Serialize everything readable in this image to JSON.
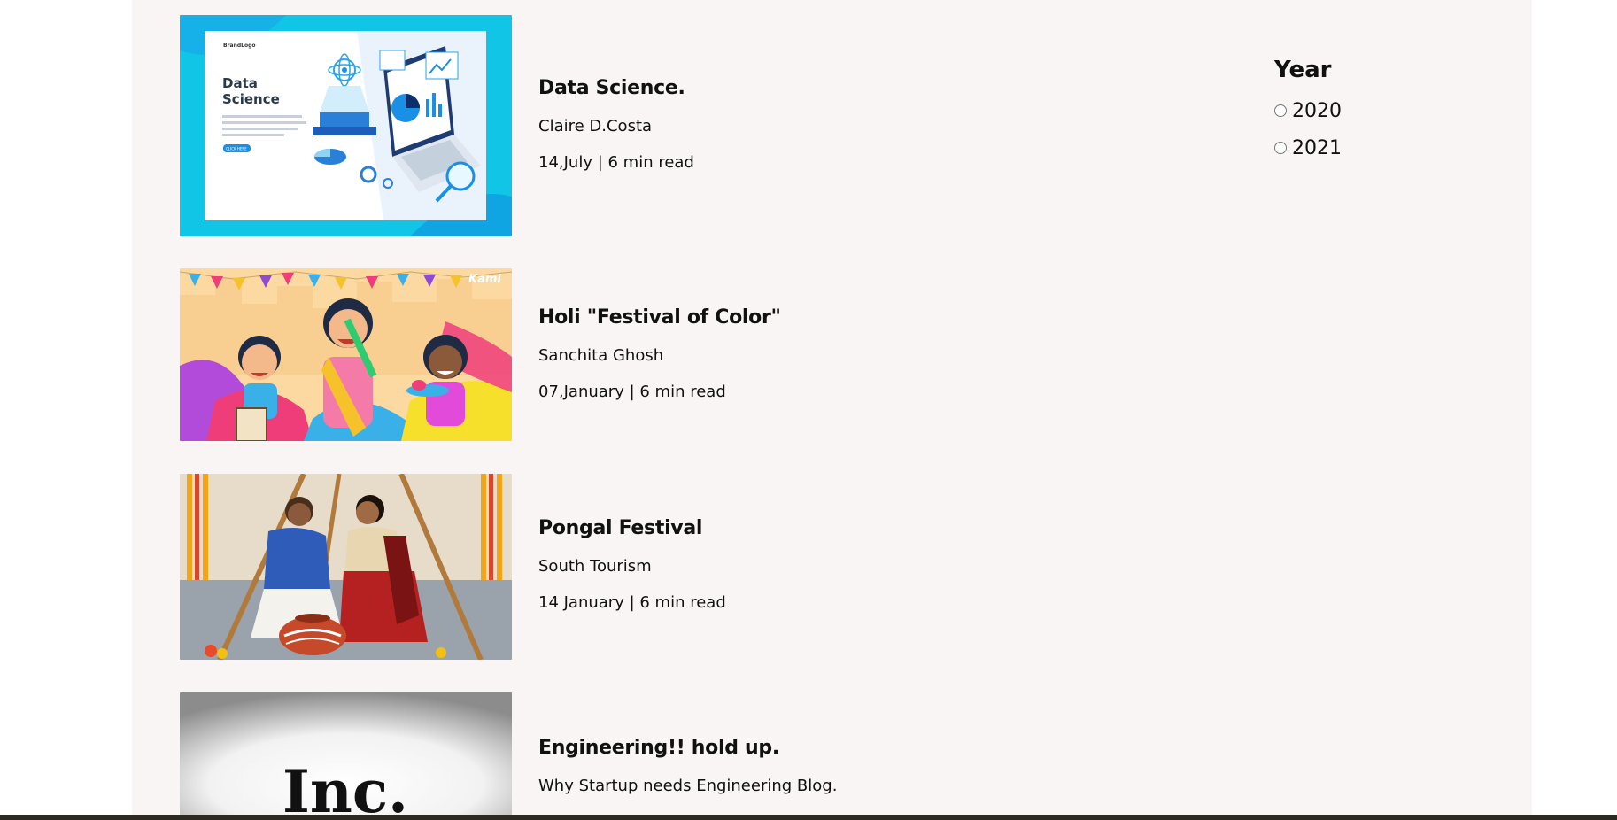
{
  "posts": [
    {
      "title": "Data Science.",
      "author": "Claire D.Costa",
      "date": "14,July | 6 min read",
      "image": {
        "brand": "BrandLogo",
        "heading_line1": "Data",
        "heading_line2": "Science",
        "button": "CLICK HERE"
      }
    },
    {
      "title": "Holi \"Festival of Color\"",
      "author": "Sanchita Ghosh",
      "date": "07,January | 6 min read",
      "image": {
        "watermark": "Kami"
      }
    },
    {
      "title": "Pongal Festival",
      "author": "South Tourism",
      "date": "14 January | 6 min read"
    },
    {
      "title": "Engineering!! hold up.",
      "author": "Why Startup needs Engineering Blog.",
      "image": {
        "logo_text": "Inc."
      }
    }
  ],
  "filter": {
    "heading": "Year",
    "options": [
      "2020",
      "2021"
    ]
  },
  "colors": {
    "page_background": "#f9f5f4",
    "text": "#111111",
    "bottom_bar": "#2c2a21"
  }
}
